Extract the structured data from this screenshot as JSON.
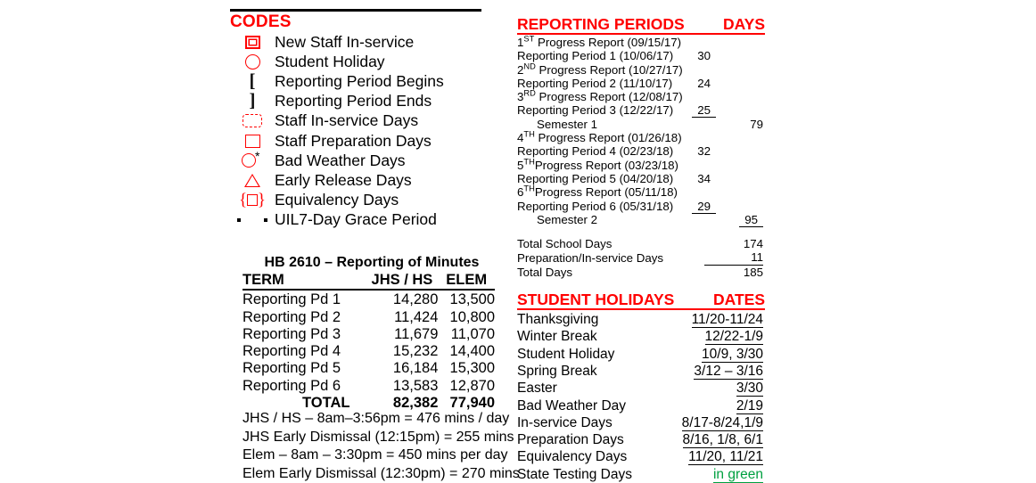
{
  "codes": {
    "title": "CODES",
    "items": [
      {
        "icon": "double-square-icon",
        "label": "New Staff In-service"
      },
      {
        "icon": "circle-icon",
        "label": "Student Holiday"
      },
      {
        "icon": "left-bracket-icon",
        "glyph": "[",
        "label": "Reporting Period Begins"
      },
      {
        "icon": "right-bracket-icon",
        "glyph": "]",
        "label": "Reporting Period Ends"
      },
      {
        "icon": "dashed-braces-icon",
        "label": "Staff In-service Days"
      },
      {
        "icon": "square-icon",
        "label": "Staff Preparation Days"
      },
      {
        "icon": "circle-asterisk-icon",
        "label": "Bad Weather Days"
      },
      {
        "icon": "triangle-icon",
        "label": "Early Release Days"
      },
      {
        "icon": "braces-square-icon",
        "label": "Equivalency Days"
      },
      {
        "icon": "two-dots-icon",
        "label": "UIL7-Day Grace Period"
      }
    ]
  },
  "hb2610": {
    "title": "HB 2610 – Reporting of Minutes",
    "headers": {
      "term": "TERM",
      "jhs": "JHS / HS",
      "elem": "ELEM"
    },
    "rows": [
      {
        "term": "Reporting Pd 1",
        "jhs": "14,280",
        "elem": "13,500"
      },
      {
        "term": "Reporting Pd 2",
        "jhs": "11,424",
        "elem": "10,800"
      },
      {
        "term": "Reporting Pd 3",
        "jhs": "11,679",
        "elem": "11,070"
      },
      {
        "term": "Reporting Pd 4",
        "jhs": "15,232",
        "elem": "14,400"
      },
      {
        "term": "Reporting Pd 5",
        "jhs": "16,184",
        "elem": "15,300"
      },
      {
        "term": "Reporting Pd 6",
        "jhs": "13,583",
        "elem": "12,870"
      }
    ],
    "total": {
      "term": "TOTAL",
      "jhs": "82,382",
      "elem": "77,940"
    }
  },
  "notes": [
    "JHS / HS – 8am–3:56pm = 476 mins / day",
    "JHS Early Dismissal (12:15pm) = 255 mins",
    "Elem – 8am – 3:30pm = 450 mins per day",
    "Elem Early Dismissal (12:30pm) = 270 mins"
  ],
  "reporting_periods": {
    "title": "REPORTING PERIODS",
    "days_label": "DAYS",
    "rows": [
      {
        "ord": "1",
        "sup": "ST",
        "name": " Progress Report (09/15/17)",
        "days": "",
        "sem": ""
      },
      {
        "ord": "",
        "sup": "",
        "name": "Reporting Period 1 (10/06/17)",
        "days": "30",
        "sem": ""
      },
      {
        "ord": "2",
        "sup": "ND",
        "name": " Progress Report (10/27/17)",
        "days": "",
        "sem": ""
      },
      {
        "ord": "",
        "sup": "",
        "name": "Reporting Period 2 (11/10/17)",
        "days": "24",
        "sem": ""
      },
      {
        "ord": "3",
        "sup": "RD",
        "name": " Progress Report (12/08/17)",
        "days": "",
        "sem": ""
      },
      {
        "ord": "",
        "sup": "",
        "name": "Reporting Period 3 (12/22/17)",
        "days": "25",
        "sem": "",
        "days_underline": true
      },
      {
        "ord": "",
        "sup": "",
        "name": "Semester 1",
        "days": "",
        "sem": "79",
        "center": true
      },
      {
        "ord": "4",
        "sup": "TH",
        "name": " Progress Report (01/26/18)",
        "days": "",
        "sem": ""
      },
      {
        "ord": "",
        "sup": "",
        "name": "Reporting Period 4 (02/23/18)",
        "days": "32",
        "sem": ""
      },
      {
        "ord": "5",
        "sup": "TH",
        "name": "Progress Report (03/23/18)",
        "days": "",
        "sem": ""
      },
      {
        "ord": "",
        "sup": "",
        "name": "Reporting Period 5 (04/20/18)",
        "days": "34",
        "sem": ""
      },
      {
        "ord": "6",
        "sup": "TH",
        "name": "Progress Report (05/11/18)",
        "days": "",
        "sem": ""
      },
      {
        "ord": "",
        "sup": "",
        "name": "Reporting Period 6 (05/31/18)",
        "days": "29",
        "sem": "",
        "days_underline": true
      },
      {
        "ord": "",
        "sup": "",
        "name": "Semester 2",
        "days": "",
        "sem": "95",
        "center": true,
        "sem_underline": true
      }
    ]
  },
  "totals": {
    "rows": [
      {
        "label": "Total School Days",
        "value": "174"
      },
      {
        "label": "Preparation/In-service Days",
        "value": "11",
        "rule": true
      },
      {
        "label": "Total Days",
        "value": "185"
      }
    ]
  },
  "student_holidays": {
    "title": "STUDENT HOLIDAYS",
    "dates_label": "DATES",
    "rows": [
      {
        "label": "Thanksgiving",
        "dates": "11/20-11/24"
      },
      {
        "label": "Winter Break",
        "dates": "12/22-1/9"
      },
      {
        "label": "Student Holiday",
        "dates": "10/9, 3/30"
      },
      {
        "label": "Spring Break",
        "dates": "3/12 – 3/16"
      },
      {
        "label": "Easter",
        "dates": "3/30"
      },
      {
        "label": "Bad Weather Day",
        "dates": "2/19"
      },
      {
        "label": "In-service Days",
        "dates": "8/17-8/24,1/9"
      },
      {
        "label": "Preparation Days",
        "dates": "8/16, 1/8, 6/1"
      },
      {
        "label": "Equivalency Days",
        "dates": "11/20, 11/21"
      },
      {
        "label": "State Testing Days",
        "dates": "in green",
        "green": true
      }
    ]
  },
  "colors": {
    "accent_red": "#ff0000",
    "green": "#00a040",
    "text": "#000000"
  }
}
